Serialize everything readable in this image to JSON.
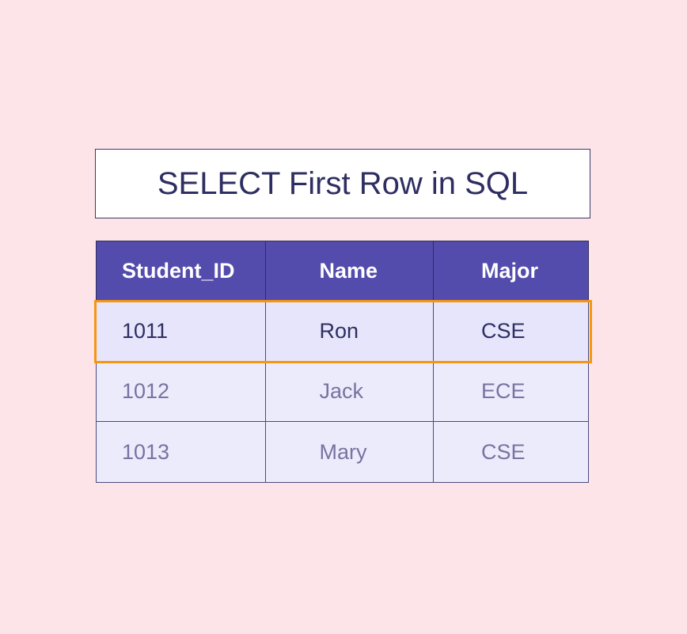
{
  "title": "SELECT First Row in SQL",
  "table": {
    "headers": [
      "Student_ID",
      "Name",
      "Major"
    ],
    "rows": [
      [
        "1011",
        "Ron",
        "CSE"
      ],
      [
        "1012",
        "Jack",
        "ECE"
      ],
      [
        "1013",
        "Mary",
        "CSE"
      ]
    ],
    "highlighted_row_index": 0
  },
  "colors": {
    "background": "#fde4e8",
    "header_bg": "#544cad",
    "row_bg": "#ecebfc",
    "highlight_border": "#f6960f",
    "title_text": "#2e2e62",
    "muted_text": "#7674a0"
  }
}
